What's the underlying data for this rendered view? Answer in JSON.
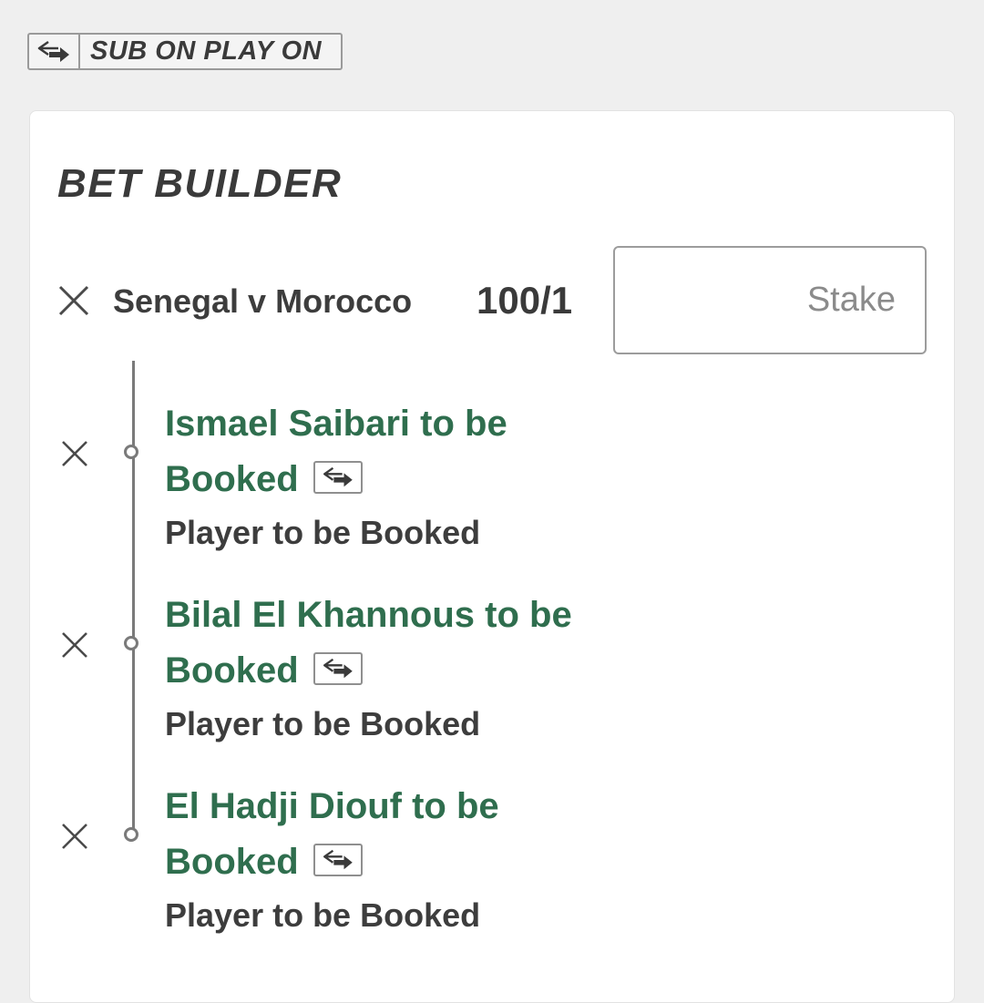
{
  "sub_badge": {
    "label": "SUB ON PLAY ON",
    "icon": "swap-arrows-icon"
  },
  "card": {
    "title": "BET BUILDER",
    "event": {
      "name": "Senegal v Morocco",
      "odds": "100/1"
    },
    "stake": {
      "placeholder": "Stake",
      "value": ""
    },
    "selections": [
      {
        "title_line1": "Ismael Saibari to be",
        "title_line2": "Booked",
        "market": "Player to be Booked"
      },
      {
        "title_line1": "Bilal El Khannous to be",
        "title_line2": "Booked",
        "market": "Player to be Booked"
      },
      {
        "title_line1": "El Hadji Diouf to be",
        "title_line2": "Booked",
        "market": "Player to be Booked"
      }
    ]
  },
  "colors": {
    "accent_green": "#2f6e4e",
    "text_dark": "#3d3d3d",
    "background": "#efefef"
  }
}
